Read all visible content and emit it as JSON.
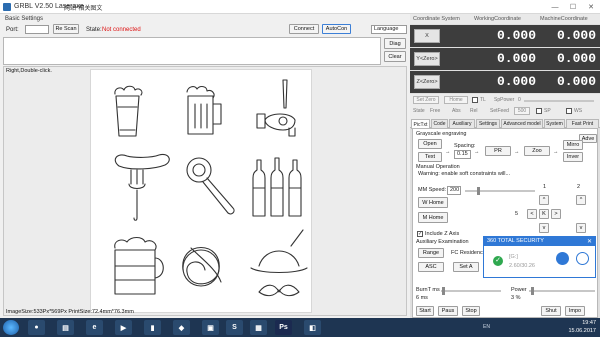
{
  "window": {
    "title": "GRBL V2.50 Laseraxe",
    "subtitle": "网站*相关图文",
    "min": "—",
    "max": "☐",
    "close": "✕"
  },
  "basic": {
    "label": "Basic Settings",
    "port_label": "Port:",
    "port_value": "",
    "rescan": "Re Scan",
    "state_label": "State:",
    "state_value": "Not connected",
    "connect": "Connect",
    "autocon": "AutoCon",
    "language": "Language",
    "diag": "Diag",
    "clear": "Clear"
  },
  "canvas": {
    "hint": "Right,Double-click.",
    "image_size": "ImageSize:533Px*569Px  PrintSize:72.4mm*76.3mm"
  },
  "coords": {
    "header": [
      "Coordinate System",
      "WorkingCoordinate",
      "MachineCoordinate"
    ],
    "rows": [
      {
        "axis": "X",
        "work": "0.000",
        "machine": "0.000"
      },
      {
        "axis": "Y<Zero>",
        "work": "0.000",
        "machine": "0.000"
      },
      {
        "axis": "Z<Zero>",
        "work": "0.000",
        "machine": "0.000"
      }
    ]
  },
  "controls": {
    "set_zero": "Set Zero",
    "home": "Home",
    "state": "State",
    "free": "Free",
    "spindle": "SpPower",
    "sp_val": "0",
    "abs": "Abs",
    "rel": "Rel",
    "feed": "SetFeed",
    "feed_val": "500",
    "sp": "SP",
    "ws": "WS",
    "tl": "TL"
  },
  "tabs": [
    "PicTxt",
    "Code",
    "Auxiliary",
    "Settings",
    "Advanced model",
    "System",
    "Fast Print"
  ],
  "panel": {
    "grayscale": "Grayscale engraving",
    "adve": "Adve",
    "open": "Open",
    "text": "Text",
    "spacing": "Spacing:",
    "spacing_val": "0.15",
    "pr": "PR",
    "zoo": "Zoo",
    "mirro": "Mirro",
    "inver": "Inver",
    "manual": "Manual Operation",
    "warning": "Warning: enable soft constraints will...",
    "mm_speed": "MM  Speed:",
    "speed_val": "200",
    "w_home": "W Home",
    "m_home": "M Home",
    "n1": "1",
    "n2": "2",
    "n5": "5",
    "include": "Include Z Axis",
    "aux": "Auxiliary Examination",
    "range": "Range",
    "fc": "FC Residence",
    "asc": "ASC",
    "seta": "Set A",
    "burn": "BurnT ms",
    "burn_val": "6 ms",
    "power": "Power",
    "power_val": "3 %",
    "start": "Start",
    "pause": "Paus",
    "stop": "Stop",
    "shut": "Shut",
    "impo": "Impo"
  },
  "security": {
    "title": "360 TOTAL SECURITY",
    "line1": "[G:]",
    "line2": "2.60/30.26"
  },
  "tray": {
    "lang": "EN",
    "time": "19:47",
    "date": "15.06.2017"
  }
}
